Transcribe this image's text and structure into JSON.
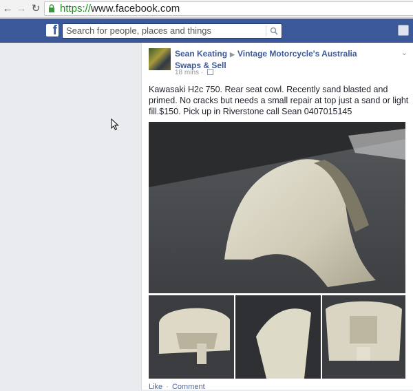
{
  "browser": {
    "url_scheme": "https://",
    "url_rest": "www.facebook.com"
  },
  "fb": {
    "logo": "f",
    "search_placeholder": "Search for people, places and things"
  },
  "post": {
    "author": "Sean Keating",
    "group": "Vintage Motorcycle's Australia Swaps & Sell",
    "time": "18 mins",
    "time_sep": "·",
    "text": "Kawasaki H2c 750. Rear seat cowl. Recently sand blasted and primed. No cracks but needs a small repair at top just a sand or light fill.$150. Pick up in Riverstone call Sean 0407015145",
    "actions": {
      "like": "Like",
      "sep": "·",
      "comment": "Comment"
    }
  },
  "colors": {
    "fb_blue": "#3b5998",
    "link": "#3b5998",
    "page_bg": "#e9ebee"
  },
  "icons": [
    "back-icon",
    "forward-icon",
    "reload-icon",
    "lock-icon",
    "facebook-logo",
    "search-icon",
    "privacy-icon",
    "chevron-down-icon",
    "mouse-cursor-icon"
  ]
}
